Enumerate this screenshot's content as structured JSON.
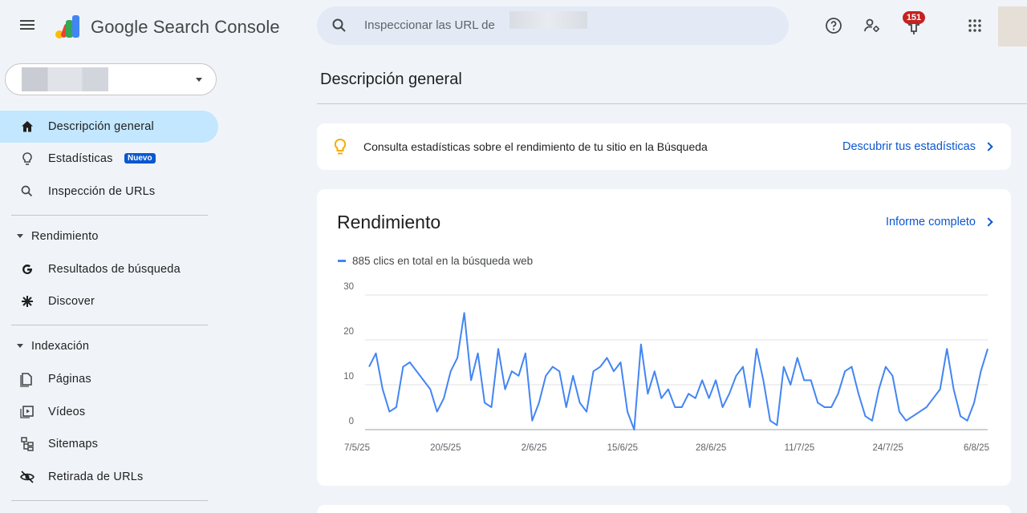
{
  "header": {
    "brand": "Google Search Console",
    "search_placeholder": "Inspeccionar las URL de",
    "notification_count": "151",
    "icons": [
      "menu-icon",
      "search-icon",
      "help-icon",
      "manage-users-icon",
      "notifications-icon",
      "apps-grid-icon"
    ]
  },
  "sidebar": {
    "items_top": [
      {
        "label": "Descripción general",
        "icon": "home-icon",
        "active": true
      },
      {
        "label": "Estadísticas",
        "icon": "lightbulb-icon",
        "badge": "Nuevo"
      },
      {
        "label": "Inspección de URLs",
        "icon": "search-icon"
      }
    ],
    "section_performance": {
      "label": "Rendimiento",
      "items": [
        {
          "label": "Resultados de búsqueda",
          "icon": "google-g-icon"
        },
        {
          "label": "Discover",
          "icon": "asterisk-icon"
        }
      ]
    },
    "section_indexing": {
      "label": "Indexación",
      "items": [
        {
          "label": "Páginas",
          "icon": "pages-icon"
        },
        {
          "label": "Vídeos",
          "icon": "video-icon"
        },
        {
          "label": "Sitemaps",
          "icon": "sitemap-icon"
        },
        {
          "label": "Retirada de URLs",
          "icon": "eye-off-icon"
        }
      ]
    }
  },
  "main": {
    "title": "Descripción general",
    "insight": {
      "text": "Consulta estadísticas sobre el rendimiento de tu sitio en la Búsqueda",
      "link": "Descubrir tus estadísticas"
    },
    "performance": {
      "title": "Rendimiento",
      "link": "Informe completo",
      "legend": "885 clics en total en la búsqueda web"
    }
  },
  "colors": {
    "accent": "#0b57d0",
    "series": "#4285f4",
    "active_nav": "#c2e7ff",
    "badge": "#c5221f"
  },
  "chart_data": {
    "type": "line",
    "ylim": [
      0,
      30
    ],
    "yticks": [
      "0",
      "10",
      "20",
      "30"
    ],
    "xtick_labels": [
      "7/5/25",
      "20/5/25",
      "2/6/25",
      "15/6/25",
      "28/6/25",
      "11/7/25",
      "24/7/25",
      "6/8/25"
    ],
    "series": [
      {
        "name": "885 clics en total en la búsqueda web",
        "values": [
          14,
          17,
          9,
          4,
          5,
          14,
          15,
          13,
          11,
          9,
          4,
          7,
          13,
          16,
          26,
          11,
          17,
          6,
          5,
          18,
          9,
          13,
          12,
          17,
          2,
          6,
          12,
          14,
          13,
          5,
          12,
          6,
          4,
          13,
          14,
          16,
          13,
          15,
          4,
          0,
          19,
          8,
          13,
          7,
          9,
          5,
          5,
          8,
          7,
          11,
          7,
          11,
          5,
          8,
          12,
          14,
          5,
          18,
          11,
          2,
          1,
          14,
          10,
          16,
          11,
          11,
          6,
          5,
          5,
          8,
          13,
          14,
          8,
          3,
          2,
          9,
          14,
          12,
          4,
          2,
          3,
          4,
          5,
          7,
          9,
          18,
          9,
          3,
          2,
          6,
          13,
          18
        ]
      }
    ]
  }
}
